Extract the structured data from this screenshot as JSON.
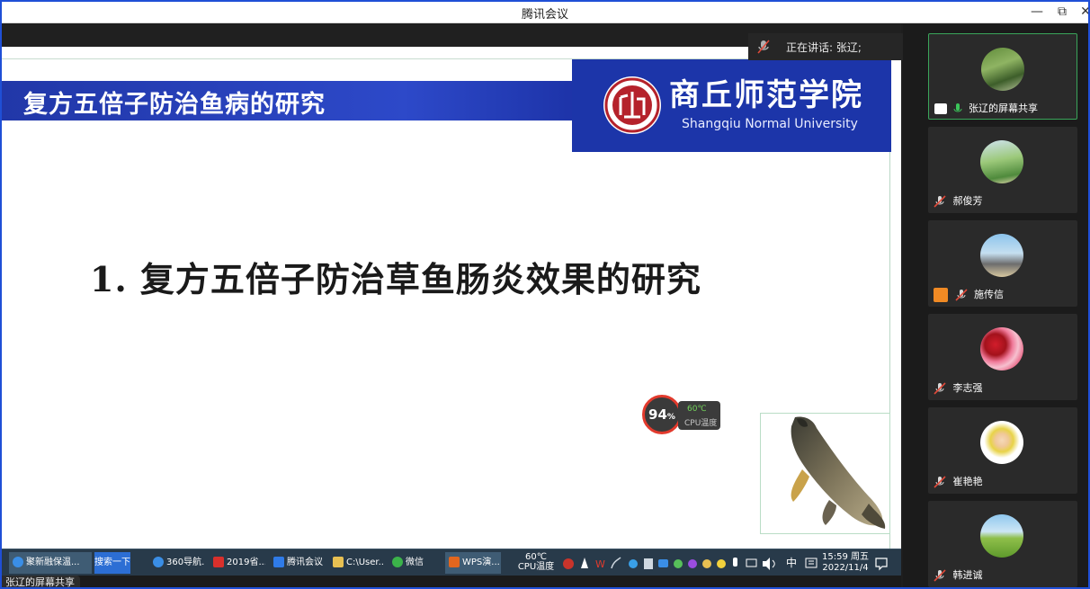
{
  "window": {
    "title": "腾讯会议",
    "minimize_glyph": "—",
    "restore_glyph": "⧉",
    "close_glyph": "✕"
  },
  "speaking": {
    "label": "正在讲话: 张辽;"
  },
  "slide": {
    "title": "复方五倍子防治鱼病的研究",
    "university_cn": "商丘师范学院",
    "university_en": "Shangqiu Normal University",
    "heading": "1. 复方五倍子防治草鱼肠炎效果的研究"
  },
  "cpu_widget": {
    "usage_value": "94",
    "usage_unit": "%",
    "temp": "60℃",
    "label": "CPU温度"
  },
  "taskbar": {
    "items": [
      {
        "label": "聚新融保温...",
        "icon": "ie-icon",
        "color": "#3a8ee6"
      },
      {
        "label": "搜索一下",
        "icon": "",
        "color": ""
      },
      {
        "label": "360导航...",
        "icon": "ie-icon",
        "color": "#3a8ee6"
      },
      {
        "label": "2019省...",
        "icon": "wps-writer-icon",
        "color": "#d9302c"
      },
      {
        "label": "腾讯会议",
        "icon": "tencent-meeting-icon",
        "color": "#2f7be8"
      },
      {
        "label": "C:\\User...",
        "icon": "folder-icon",
        "color": "#e8c052"
      },
      {
        "label": "微信",
        "icon": "wechat-icon",
        "color": "#3bb34a"
      },
      {
        "label": "WPS演...",
        "icon": "wps-presentation-icon",
        "color": "#e2661e"
      }
    ],
    "cpu_temp": "60℃",
    "cpu_label": "CPU温度",
    "ime": "中",
    "time": "15:59 周五",
    "date": "2022/11/4"
  },
  "share_tag": "张辽的屏幕共享",
  "participants": [
    {
      "name": "张辽的屏幕共享",
      "active": true,
      "avatar": "garden-photo"
    },
    {
      "name": "郝俊芳",
      "active": false,
      "avatar": "outdoor-photo"
    },
    {
      "name": "施传信",
      "active": false,
      "avatar": "street-photo"
    },
    {
      "name": "李志强",
      "active": false,
      "avatar": "roses-photo"
    },
    {
      "name": "崔艳艳",
      "active": false,
      "avatar": "child-photo"
    },
    {
      "name": "韩进诚",
      "active": false,
      "avatar": "landscape-photo"
    }
  ],
  "colors": {
    "accent_blue": "#1f4fd6",
    "slide_band": "#2d49c9",
    "active_border": "#3aa55a",
    "cpu_ring": "#e23a2d"
  }
}
